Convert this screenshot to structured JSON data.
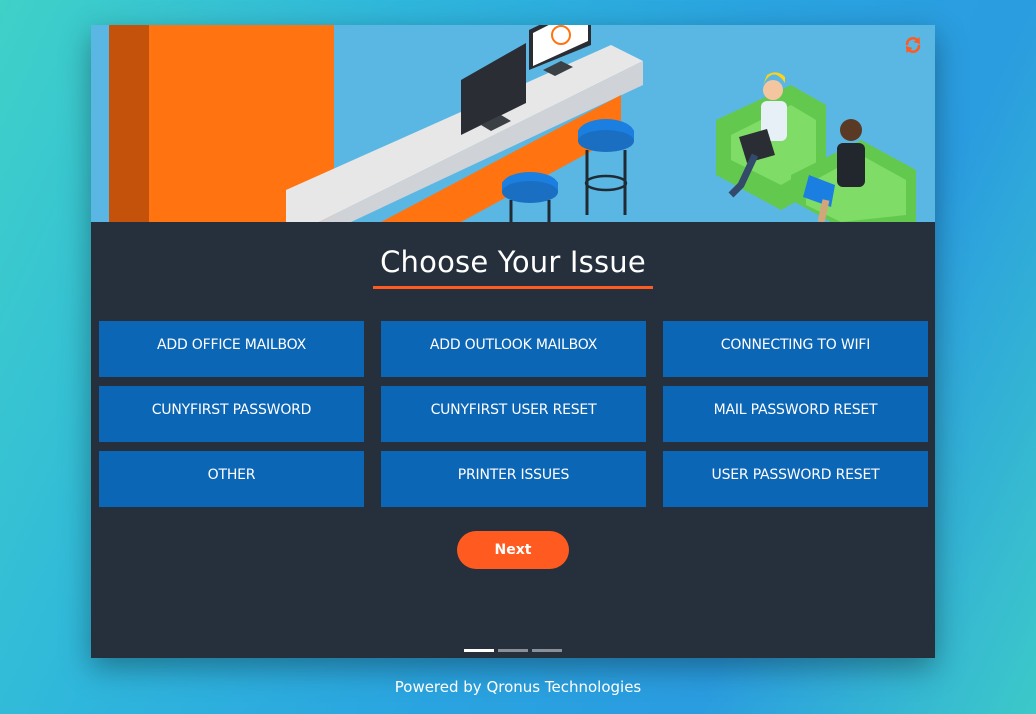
{
  "colors": {
    "accent": "#ff5a1f",
    "button_blue": "#0c66b6",
    "panel_dark": "#25303c",
    "hero_sky": "#5ab7e4"
  },
  "hero": {
    "illustration": "help-desk-office-illustration",
    "refresh_icon": "refresh-icon"
  },
  "main": {
    "title": "Choose Your Issue",
    "issues": [
      {
        "label": "ADD OFFICE MAILBOX"
      },
      {
        "label": "ADD OUTLOOK MAILBOX"
      },
      {
        "label": "CONNECTING TO WIFI"
      },
      {
        "label": "CUNYFIRST PASSWORD"
      },
      {
        "label": "CUNYFIRST USER RESET"
      },
      {
        "label": "MAIL PASSWORD RESET"
      },
      {
        "label": "OTHER"
      },
      {
        "label": "PRINTER ISSUES"
      },
      {
        "label": "USER PASSWORD RESET"
      }
    ],
    "next_label": "Next",
    "pagination": {
      "pages": 3,
      "current": 1
    }
  },
  "footer": {
    "text": "Powered by Qronus Technologies"
  }
}
